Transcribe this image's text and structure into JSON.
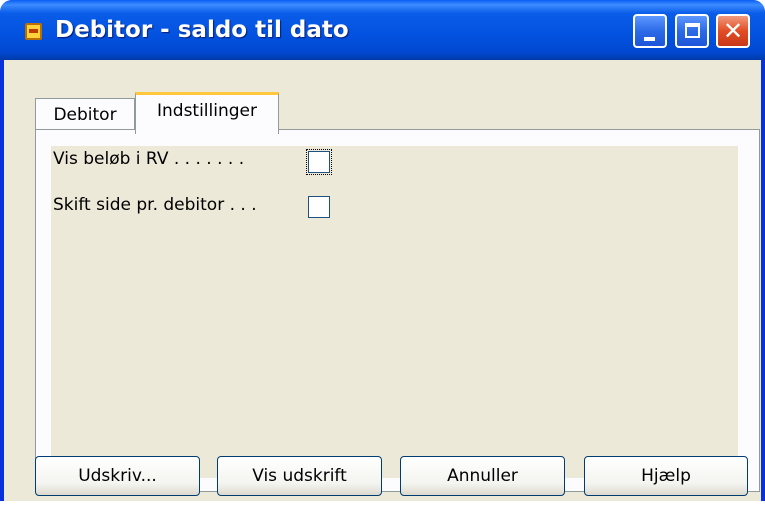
{
  "window": {
    "title": "Debitor - saldo til dato"
  },
  "tabs": [
    {
      "label": "Debitor",
      "active": false
    },
    {
      "label": "Indstillinger",
      "active": true
    }
  ],
  "fields": [
    {
      "label": "Vis beløb i RV . . . . . . .",
      "checked": false
    },
    {
      "label": "Skift side pr. debitor . . .",
      "checked": false
    }
  ],
  "buttons": {
    "print": "Udskriv...",
    "preview": "Vis udskrift",
    "cancel": "Annuller",
    "help": "Hjælp"
  },
  "titlebar_buttons": {
    "minimize": "_",
    "maximize": "□",
    "close": "✕"
  },
  "colors": {
    "titlebar": "#0351e0",
    "dialog_bg": "#ece9d8",
    "active_tab_accent": "#ffc83c",
    "close_button": "#e24d26"
  }
}
